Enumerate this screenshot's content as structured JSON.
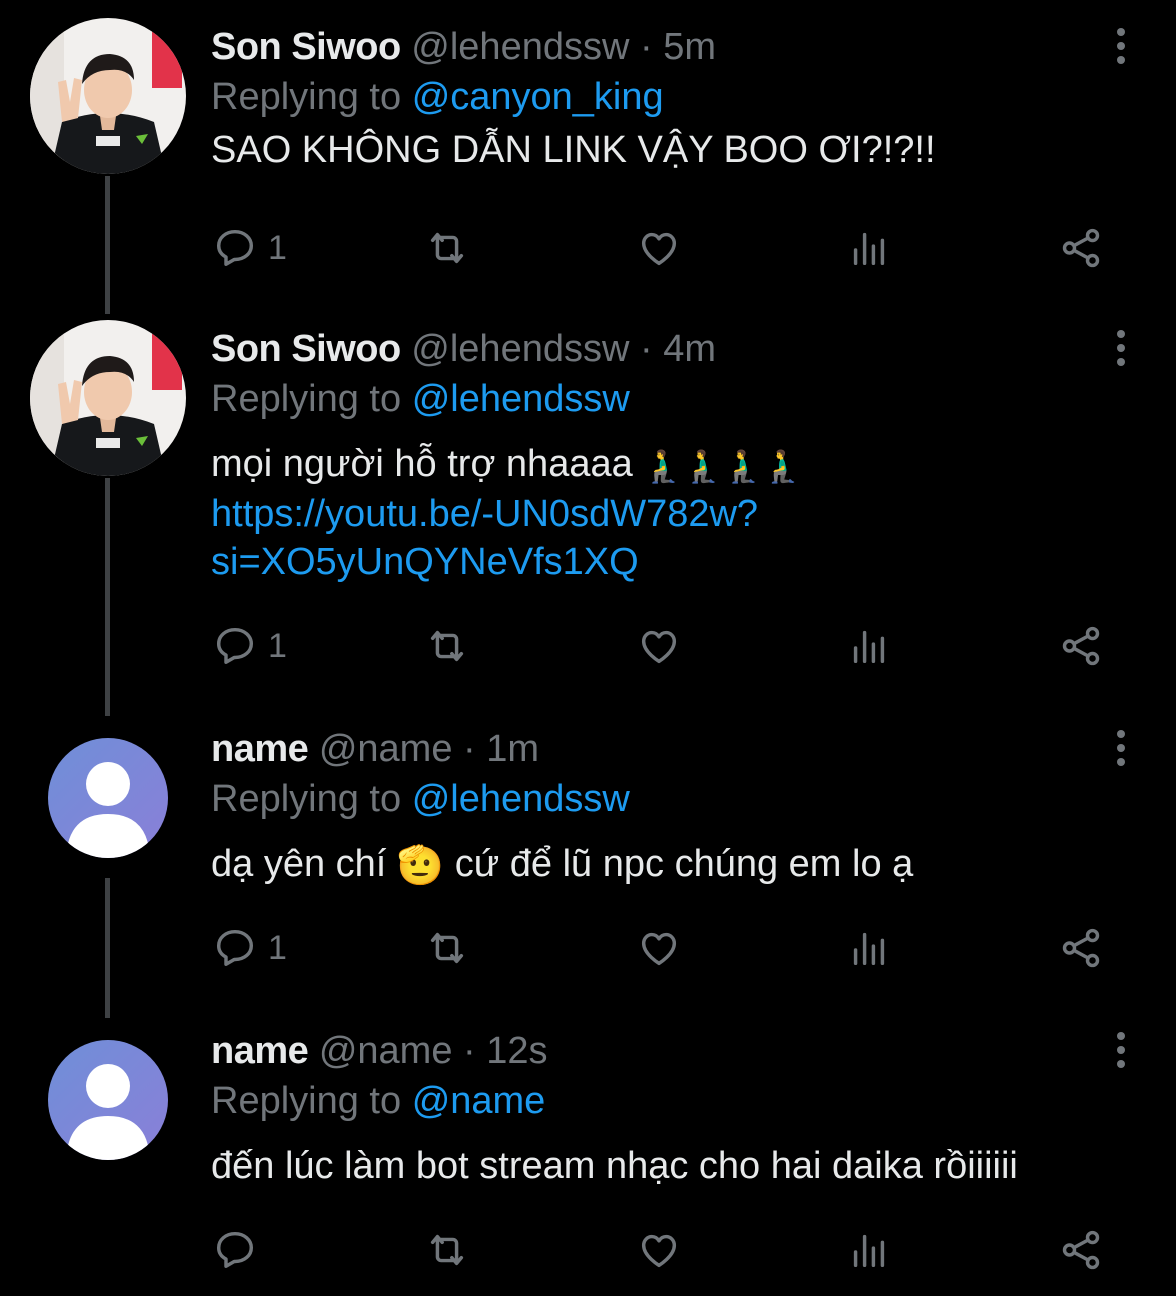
{
  "colors": {
    "background": "#000000",
    "text": "#e7e9ea",
    "secondary": "#71767b",
    "accent": "#1d9bf0",
    "thread_line": "#3e4144"
  },
  "tweets": [
    {
      "name": "Son Siwoo",
      "handle": "@lehendssw",
      "dot": "·",
      "time": "5m",
      "reply_prefix": "Replying to",
      "reply_to": "@canyon_king",
      "text": "SAO KHÔNG DẪN LINK VẬY BOO ƠI?!?!!",
      "reply_count": "1",
      "avatar": "photo-avatar"
    },
    {
      "name": "Son Siwoo",
      "handle": "@lehendssw",
      "dot": "·",
      "time": "4m",
      "reply_prefix": "Replying to",
      "reply_to": "@lehendssw",
      "text": "mọi người hỗ trợ nhaaaa",
      "emoji": "🧎‍♂️🧎‍♂️🧎‍♂️🧎‍♂️",
      "link_line1": "https://youtu.be/-UN0sdW782w?",
      "link_line2": "si=XO5yUnQYNeVfs1XQ",
      "reply_count": "1",
      "avatar": "photo-avatar"
    },
    {
      "name": "name",
      "handle": "@name",
      "dot": "·",
      "time": "1m",
      "reply_prefix": "Replying to",
      "reply_to": "@lehendssw",
      "text_before": "dạ yên chí",
      "emoji": "🫡",
      "text_after": "cứ để lũ npc chúng em lo ạ",
      "reply_count": "1",
      "avatar": "default-avatar"
    },
    {
      "name": "name",
      "handle": "@name",
      "dot": "·",
      "time": "12s",
      "reply_prefix": "Replying to",
      "reply_to": "@name",
      "text": "đến lúc làm bot stream nhạc cho hai daika rồiiiiii",
      "reply_count": "",
      "avatar": "default-avatar"
    }
  ],
  "icons": [
    "reply-icon",
    "retweet-icon",
    "like-icon",
    "views-icon",
    "share-icon",
    "more-icon"
  ]
}
